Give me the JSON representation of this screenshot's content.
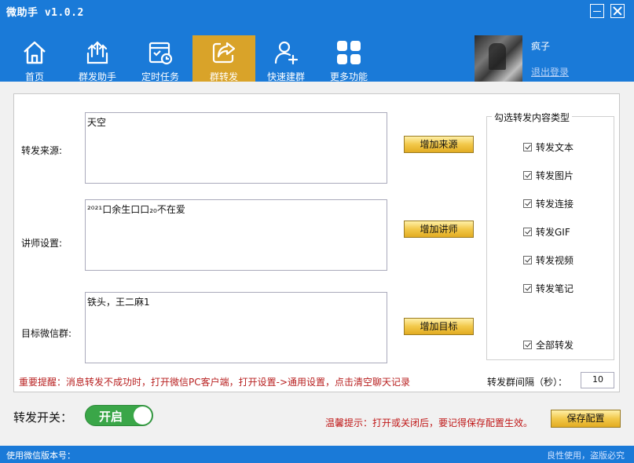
{
  "window": {
    "title": "微助手 v1.0.2"
  },
  "nav": {
    "items": [
      {
        "label": "首页",
        "icon": "home-icon"
      },
      {
        "label": "群发助手",
        "icon": "broadcast-icon"
      },
      {
        "label": "定时任务",
        "icon": "schedule-icon"
      },
      {
        "label": "群转发",
        "icon": "share-forward-icon",
        "active": true
      },
      {
        "label": "快速建群",
        "icon": "add-user-icon"
      },
      {
        "label": "更多功能",
        "icon": "grid-icon"
      }
    ],
    "active_color": "#d9a329"
  },
  "user": {
    "name": "疯子",
    "logout_label": "退出登录"
  },
  "form": {
    "source_label": "转发来源:",
    "source_value": "天空",
    "add_source_btn": "增加来源",
    "lecturer_label": "讲师设置:",
    "lecturer_value": "²⁰²¹口余生口口₂₀不在爱",
    "add_lecturer_btn": "增加讲师",
    "target_label": "目标微信群:",
    "target_value": "铁头，王二麻1",
    "add_target_btn": "增加目标"
  },
  "content_types": {
    "title": "勾选转发内容类型",
    "items": [
      {
        "label": "转发文本",
        "checked": true
      },
      {
        "label": "转发图片",
        "checked": true
      },
      {
        "label": "转发连接",
        "checked": true
      },
      {
        "label": "转发GIF",
        "checked": true
      },
      {
        "label": "转发视频",
        "checked": true
      },
      {
        "label": "转发笔记",
        "checked": true
      }
    ],
    "all": {
      "label": "全部转发",
      "checked": true
    }
  },
  "warning": "重要提醒：消息转发不成功时，打开微信PC客户端，打开设置->通用设置，点击清空聊天记录",
  "interval": {
    "label": "转发群间隔（秒）：",
    "value": "10"
  },
  "switch": {
    "label": "转发开关：",
    "state_text": "开启",
    "on": true,
    "color": "#3aa648"
  },
  "hint": "温馨提示：打开或关闭后，要记得保存配置生效。",
  "save_btn": "保存配置",
  "status": {
    "left": "使用微信版本号：",
    "right": "良性使用，盗版必究"
  },
  "colors": {
    "primary": "#1a7ad8",
    "warning": "#b82020",
    "button_gold": "#f2c84a"
  }
}
